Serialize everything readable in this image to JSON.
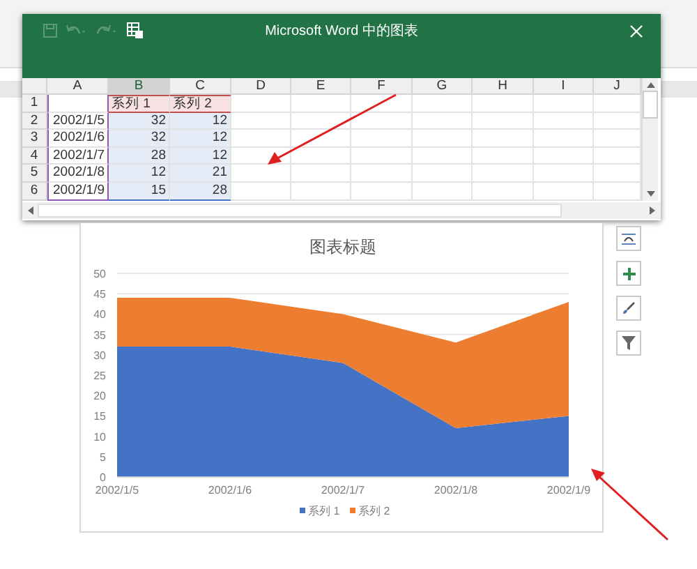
{
  "window": {
    "title": "Microsoft Word 中的图表"
  },
  "sheet": {
    "columns": [
      {
        "label": "A",
        "selected": false,
        "kind": "category"
      },
      {
        "label": "B",
        "selected": true,
        "kind": "series"
      },
      {
        "label": "C",
        "selected": false,
        "kind": "series"
      },
      {
        "label": "D",
        "selected": false,
        "kind": "plain"
      },
      {
        "label": "E",
        "selected": false,
        "kind": "plain"
      },
      {
        "label": "F",
        "selected": false,
        "kind": "plain"
      },
      {
        "label": "G",
        "selected": false,
        "kind": "plain"
      },
      {
        "label": "H",
        "selected": false,
        "kind": "plain"
      },
      {
        "label": "I",
        "selected": false,
        "kind": "plain"
      },
      {
        "label": "J",
        "selected": false,
        "kind": "plain"
      }
    ],
    "header_row": {
      "label": "1",
      "cells": [
        "系列 1",
        "系列 2"
      ]
    },
    "rows": [
      {
        "label": "2",
        "cells": [
          "2002/1/5",
          "32",
          "12"
        ]
      },
      {
        "label": "3",
        "cells": [
          "2002/1/6",
          "32",
          "12"
        ]
      },
      {
        "label": "4",
        "cells": [
          "2002/1/7",
          "28",
          "12"
        ]
      },
      {
        "label": "5",
        "cells": [
          "2002/1/8",
          "12",
          "21"
        ]
      },
      {
        "label": "6",
        "cells": [
          "2002/1/9",
          "15",
          "28"
        ]
      }
    ]
  },
  "chart": {
    "chart_data": {
      "type": "area",
      "title": "图表标题",
      "stacked": true,
      "grid": true,
      "legend": "bottom",
      "categories": [
        "2002/1/5",
        "2002/1/6",
        "2002/1/7",
        "2002/1/8",
        "2002/1/9"
      ],
      "ylim": [
        0,
        50
      ],
      "yticks": [
        0,
        5,
        10,
        15,
        20,
        25,
        30,
        35,
        40,
        45,
        50
      ],
      "series": [
        {
          "name": "系列 1",
          "color": "#4472c4",
          "values": [
            32,
            32,
            28,
            12,
            15
          ]
        },
        {
          "name": "系列 2",
          "color": "#ed7d31",
          "values": [
            12,
            12,
            12,
            21,
            28
          ]
        }
      ]
    }
  }
}
